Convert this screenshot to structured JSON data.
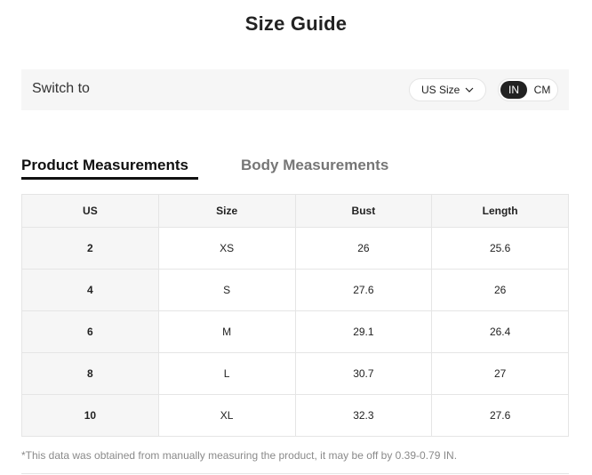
{
  "title": "Size Guide",
  "switch_bar": {
    "label": "Switch to",
    "size_select": {
      "value": "US Size",
      "icon": "chevron-down-icon"
    },
    "unit_toggle": {
      "options": [
        "IN",
        "CM"
      ],
      "selected": "IN"
    }
  },
  "tabs": [
    {
      "label": "Product Measurements",
      "active": true
    },
    {
      "label": "Body Measurements",
      "active": false
    }
  ],
  "table": {
    "headers": [
      "US",
      "Size",
      "Bust",
      "Length"
    ],
    "rows": [
      [
        "2",
        "XS",
        "26",
        "25.6"
      ],
      [
        "4",
        "S",
        "27.6",
        "26"
      ],
      [
        "6",
        "M",
        "29.1",
        "26.4"
      ],
      [
        "8",
        "L",
        "30.7",
        "27"
      ],
      [
        "10",
        "XL",
        "32.3",
        "27.6"
      ]
    ]
  },
  "footnote": "*This data was obtained from manually measuring the product, it may be off by 0.39-0.79 IN."
}
